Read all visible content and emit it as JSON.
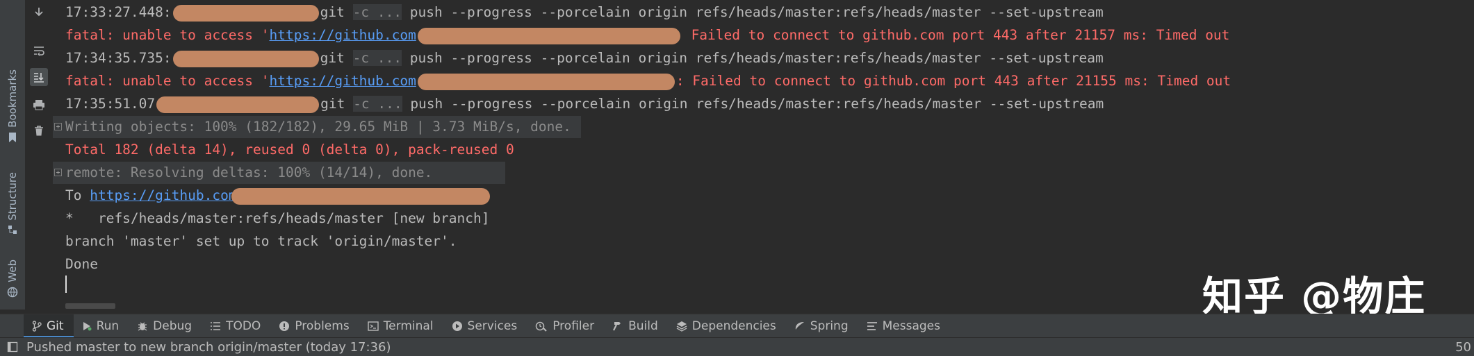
{
  "side_tabs": {
    "bookmarks": "Bookmarks",
    "structure": "Structure",
    "web": "Web"
  },
  "console": {
    "lines": [
      {
        "time": "17:33:27.448:",
        "cmd": "git",
        "flag": "-c ...",
        "rest": " push --progress --porcelain origin refs/heads/master:refs/heads/master --set-upstream"
      },
      {
        "prefix": "fatal: unable to access '",
        "link": "https://github.com",
        "suffix": " Failed to connect to github.com port 443 after 21157 ms: Timed out"
      },
      {
        "time": "17:34:35.735:",
        "cmd": "git",
        "flag": "-c ...",
        "rest": " push --progress --porcelain origin refs/heads/master:refs/heads/master --set-upstream"
      },
      {
        "prefix": "fatal: unable to access '",
        "link": "https://github.com",
        "suffix": ": Failed to connect to github.com port 443 after 21155 ms: Timed out"
      },
      {
        "time": "17:35:51.07",
        "cmd": "git",
        "flag": "-c ...",
        "rest": " push --progress --porcelain origin refs/heads/master:refs/heads/master --set-upstream"
      },
      {
        "text": "Writing objects: 100% (182/182), 29.65 MiB | 3.73 MiB/s, done."
      },
      {
        "text": "Total 182 (delta 14), reused 0 (delta 0), pack-reused 0"
      },
      {
        "text": "remote: Resolving deltas: 100% (14/14), done."
      },
      {
        "prefix": "To ",
        "link": "https://github.com"
      },
      {
        "text": "*   refs/heads/master:refs/heads/master [new branch]"
      },
      {
        "text": "branch 'master' set up to track 'origin/master'."
      },
      {
        "text": "Done"
      }
    ]
  },
  "watermark": "知乎 @物庄",
  "tool_tabs": [
    {
      "label": "Git"
    },
    {
      "label": "Run"
    },
    {
      "label": "Debug"
    },
    {
      "label": "TODO"
    },
    {
      "label": "Problems"
    },
    {
      "label": "Terminal"
    },
    {
      "label": "Services"
    },
    {
      "label": "Profiler"
    },
    {
      "label": "Build"
    },
    {
      "label": "Dependencies"
    },
    {
      "label": "Spring"
    },
    {
      "label": "Messages"
    }
  ],
  "status": {
    "message": "Pushed master to new branch origin/master (today 17:36)",
    "right": "50"
  },
  "colors": {
    "error": "#ff6b68",
    "link": "#589df6",
    "accent": "#4a88c7"
  }
}
